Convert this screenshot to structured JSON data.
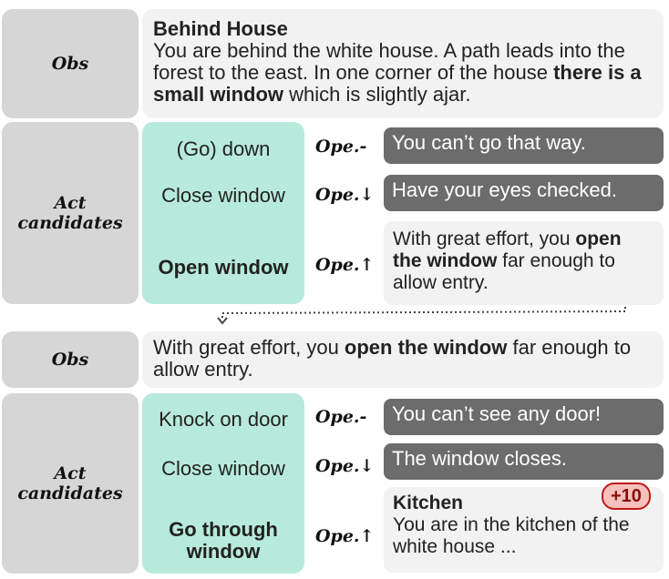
{
  "panel1": {
    "obs_label": "Obs",
    "obs": {
      "title": "Behind House",
      "text_a": "You are behind the white house. A path leads into the forest to the east. In one corner of the house ",
      "text_bold": "there is a small window",
      "text_b": " which is slightly ajar."
    },
    "act_label_1": "Act",
    "act_label_2": "candidates",
    "actions": [
      "(Go) down",
      "Close window",
      "Open window"
    ],
    "ops": [
      "Ope.-",
      "Ope.↓",
      "Ope.↑"
    ],
    "responses": {
      "r1": "You can’t go that way.",
      "r2": "Have your eyes checked.",
      "r3_a": "With great effort, you ",
      "r3_bold": "open the window",
      "r3_b": " far enough to allow entry."
    }
  },
  "panel2": {
    "obs_label": "Obs",
    "obs": {
      "text_a": "With great effort, you ",
      "text_bold": "open the window",
      "text_b": " far enough to allow entry."
    },
    "act_label_1": "Act",
    "act_label_2": "candidates",
    "actions": [
      "Knock on door",
      "Close window",
      "Go through window"
    ],
    "ops": [
      "Ope.-",
      "Ope.↓",
      "Ope.↑"
    ],
    "responses": {
      "r1": "You can’t see any door!",
      "r2": "The window closes.",
      "r3_title": "Kitchen",
      "r3_text": "You are in the kitchen of the white house ..."
    },
    "reward": "+10"
  }
}
